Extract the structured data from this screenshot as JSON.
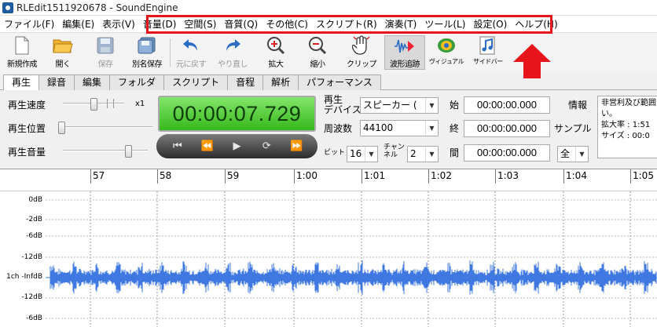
{
  "window": {
    "title": "RLEdit1511920678 - SoundEngine"
  },
  "menu": [
    "ファイル(F)",
    "編集(E)",
    "表示(V)",
    "音量(D)",
    "空間(S)",
    "音質(Q)",
    "その他(C)",
    "スクリプト(R)",
    "演奏(T)",
    "ツール(L)",
    "設定(O)",
    "ヘルプ(H)"
  ],
  "toolbar": {
    "new": "新規作成",
    "open": "開く",
    "save": "保存",
    "save_as": "別名保存",
    "undo": "元に戻す",
    "redo": "やり直し",
    "zoom_in": "拡大",
    "zoom_out": "縮小",
    "clip": "クリップ",
    "wave_follow": "波形追跡",
    "visual": "ヴィジュアル",
    "sidebar": "サイドバー"
  },
  "tabs": [
    "再生",
    "録音",
    "編集",
    "フォルダ",
    "スクリプト",
    "音程",
    "解析",
    "パフォーマンス"
  ],
  "active_tab": 0,
  "playback": {
    "rate_label": "再生速度",
    "rate_multiplier": "x1",
    "position_label": "再生位置",
    "volume_label": "再生音量",
    "time": "00:00:07.729",
    "rate_level": 0.5,
    "position_level": 0.0,
    "volume_level": 0.8
  },
  "device": {
    "label_line1": "再生",
    "label_line2": "デバイス",
    "value": "スピーカー (",
    "freq_label": "周波数",
    "freq_value": "44100",
    "bit_label": "ビット",
    "bit_value": "16",
    "channel_label_line1": "チャン",
    "channel_label_line2": "ネル",
    "channel_value": "2"
  },
  "range": {
    "start_label": "始",
    "start_value": "00:00:00.000",
    "end_label": "終",
    "end_value": "00:00:00.000",
    "len_label": "間",
    "len_value": "00:00:00.000",
    "info_label": "情報",
    "sample_label": "サンプル",
    "all_value": "全"
  },
  "info": {
    "line1": "非営利及び範囲",
    "line2": "い。",
    "line3": "拡大率 : 1:51",
    "line4": "サイズ : 00:0"
  },
  "timeline": [
    "57",
    "58",
    "59",
    "1:00",
    "1:01",
    "1:02",
    "1:03",
    "1:04",
    "1:05"
  ],
  "db_labels": [
    "0dB",
    "-2dB",
    "-6dB",
    "-12dB",
    "1ch -InfdB",
    "-12dB",
    "-6dB"
  ],
  "colors": {
    "waveform": "#3f78e0",
    "counter_green": "#4fd22f",
    "highlight_red": "#e8141c"
  }
}
